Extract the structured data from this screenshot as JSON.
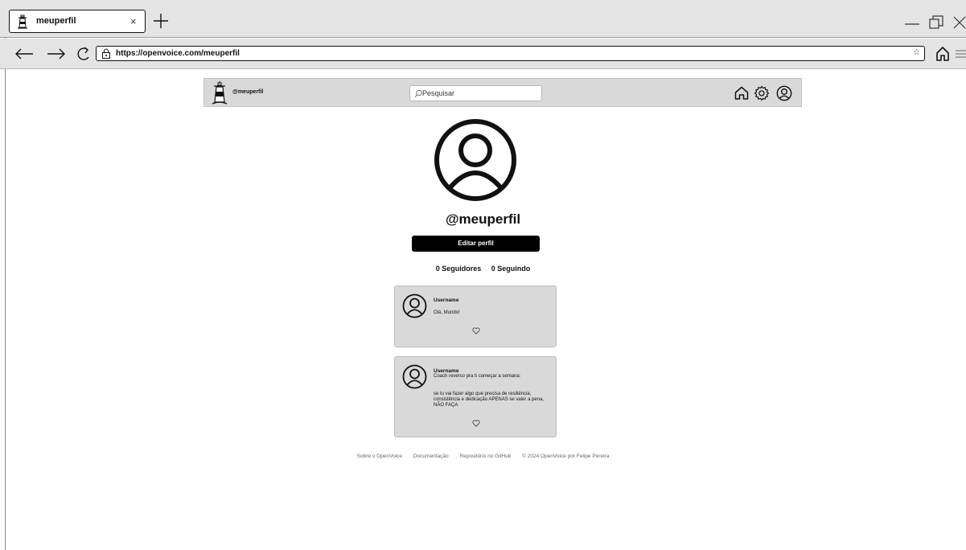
{
  "browser": {
    "tab_title": "meuperfil",
    "tab_close": "×",
    "url": "https://openvoice.com/meuperfil",
    "bookmark_star": "☆",
    "icons": [
      "lighthouse-icon",
      "close-icon",
      "plus-icon",
      "minimize-icon",
      "restore-icon",
      "close-window-icon",
      "back-arrow-icon",
      "forward-arrow-icon",
      "reload-icon",
      "lock-icon",
      "star-icon",
      "home-icon",
      "menu-icon"
    ]
  },
  "header": {
    "handle": "@meuperfil",
    "search_placeholder": "Pesquisar",
    "icons": [
      "home-icon",
      "gear-icon",
      "user-icon"
    ]
  },
  "profile": {
    "username": "@meuperfil",
    "edit_label": "Editar perfil",
    "followers": "0 Seguidores",
    "following": "0 Seguindo"
  },
  "posts": [
    {
      "user": "Username",
      "text": "Olá, Mundo!"
    },
    {
      "user": "Username",
      "title": "Coach reverso pra ti começar a semana:",
      "body": "se tu vai fazer algo que precisa de resiliência, consistência e dedicação APENAS se valer a pena, NÃO FAÇA"
    }
  ],
  "footer": {
    "links": [
      "Sobre o OpenVoice",
      "Documentação",
      "Repositório no GitHub"
    ],
    "copyright": "© 2024 OpenVoice por Felipe Pereira"
  },
  "colors": {
    "chrome": "#e4e4e4",
    "panel": "#d9d9d9",
    "button": "#000000",
    "footer_text": "#666666"
  }
}
